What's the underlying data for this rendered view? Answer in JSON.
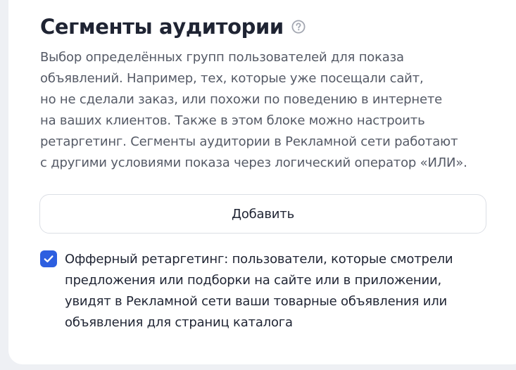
{
  "section": {
    "title": "Сегменты аудитории",
    "help_icon": "question-circle-icon",
    "description_lines": [
      "Выбор определённых групп пользователей для показа",
      "объявлений. Например, тех, которые уже посещали сайт,",
      "но не сделали заказ, или похожи по поведению в интернете",
      "на ваших клиентов. Также в этом блоке можно настроить",
      "ретаргетинг. Сегменты аудитории в Рекламной сети работают",
      "с другими условиями показа через логический оператор «ИЛИ»."
    ],
    "add_button_label": "Добавить",
    "offer_retargeting": {
      "checked": true,
      "label_lines": [
        "Офферный ретаргетинг: пользователи, которые смотрели",
        "предложения или подборки на сайте или в приложении,",
        "увидят в Рекламной сети ваши товарные объявления или",
        "объявления для страниц каталога"
      ]
    }
  },
  "colors": {
    "accent": "#2d5fe0",
    "title": "#1f2433",
    "text_secondary": "#555a66",
    "border": "#dcdfe5"
  }
}
